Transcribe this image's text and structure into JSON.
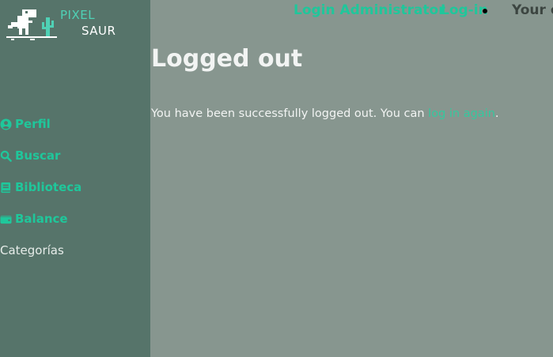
{
  "brand": {
    "word1": "PIXEL",
    "word2": "SAUR",
    "accent": "#4fd1b5"
  },
  "topbar": {
    "login_admin": "Login Administrator",
    "login": "Log-in",
    "right_text": "Your o"
  },
  "sidebar": {
    "items": [
      {
        "label": "Perfil",
        "icon": "user-circle-icon"
      },
      {
        "label": "Buscar",
        "icon": "search-icon"
      },
      {
        "label": "Biblioteca",
        "icon": "book-icon"
      },
      {
        "label": "Balance",
        "icon": "wallet-icon"
      }
    ],
    "categories_label": "Categorías"
  },
  "main": {
    "title": "Logged out",
    "message_before": "You have been successfully logged out. You can ",
    "message_link": "log in again",
    "message_after": "."
  },
  "colors": {
    "accent": "#1fc79b",
    "sidebar_bg": "#56746a",
    "page_bg": "#87968f"
  }
}
